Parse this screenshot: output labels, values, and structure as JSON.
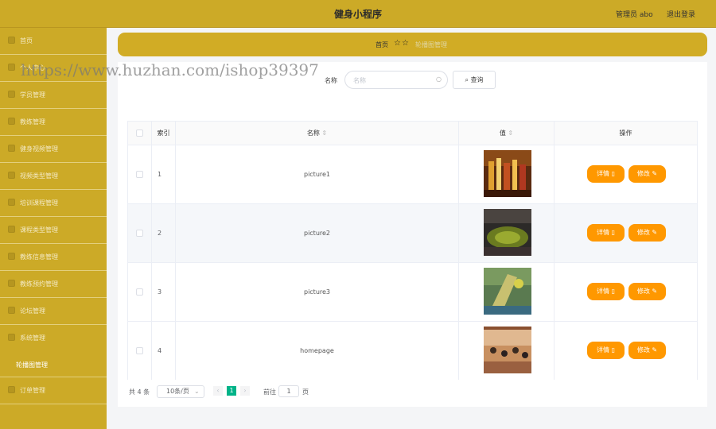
{
  "header": {
    "title": "健身小程序",
    "admin_label": "管理员 abo",
    "logout_label": "退出登录"
  },
  "sidebar": {
    "items": [
      {
        "label": "首页"
      },
      {
        "label": "个人中心"
      },
      {
        "label": "学员管理"
      },
      {
        "label": "教练管理"
      },
      {
        "label": "健身视频管理"
      },
      {
        "label": "视频类型管理"
      },
      {
        "label": "培训课程管理"
      },
      {
        "label": "课程类型管理"
      },
      {
        "label": "教练信息管理"
      },
      {
        "label": "教练预约管理"
      },
      {
        "label": "论坛管理"
      },
      {
        "label": "系统管理"
      },
      {
        "label": "订单管理"
      }
    ],
    "system_sub": "轮播图管理"
  },
  "breadcrumb": {
    "home": "首页",
    "current": "轮播图管理"
  },
  "search": {
    "label": "名称",
    "placeholder": "名称",
    "button": "查询"
  },
  "table": {
    "headers": {
      "index": "索引",
      "name": "名称",
      "value": "值",
      "actions": "操作"
    },
    "rows": [
      {
        "index": "1",
        "name": "picture1",
        "image": "basketball-crowd"
      },
      {
        "index": "2",
        "name": "picture2",
        "image": "stadium"
      },
      {
        "index": "3",
        "name": "picture3",
        "image": "tennis"
      },
      {
        "index": "4",
        "name": "homepage",
        "image": "gym-class"
      }
    ],
    "detail_label": "详情",
    "edit_label": "修改"
  },
  "pagination": {
    "total": "共 4 条",
    "page_size": "10条/页",
    "current_page": "1",
    "goto_label": "前往",
    "goto_value": "1",
    "page_unit": "页"
  },
  "watermark": "https://www.huzhan.com/ishop39397",
  "colors": {
    "sidebar": "#ccaa27",
    "action_button": "#ff9800",
    "page_active": "#00b388"
  }
}
